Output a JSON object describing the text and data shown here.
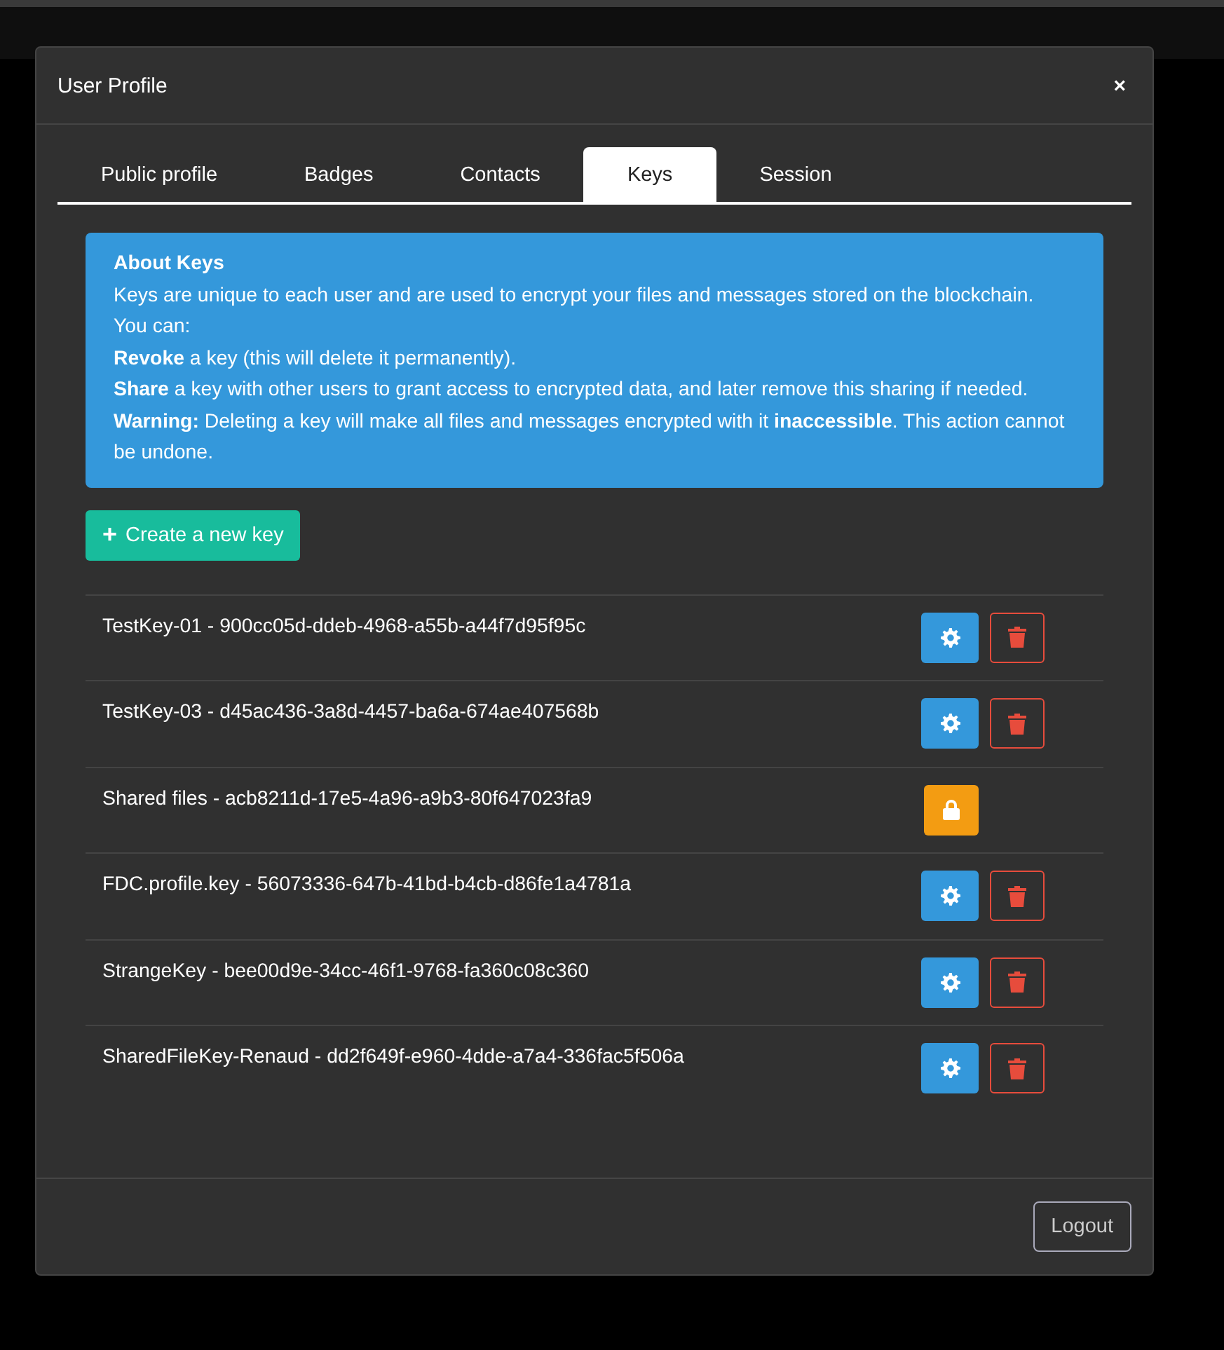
{
  "dialog": {
    "title": "User Profile",
    "close": "×"
  },
  "tabs": [
    {
      "label": "Public profile",
      "selected": false
    },
    {
      "label": "Badges",
      "selected": false
    },
    {
      "label": "Contacts",
      "selected": false
    },
    {
      "label": "Keys",
      "selected": true
    },
    {
      "label": "Session",
      "selected": false
    }
  ],
  "info": {
    "title": "About Keys",
    "lines": [
      "Keys are unique to each user and are used to encrypt your files and messages stored on the blockchain.",
      "You can:",
      "**Revoke** a key (this will delete it permanently).",
      "**Share** a key with other users to grant access to encrypted data, and later remove this sharing if needed.",
      "**Warning:** Deleting a key will make all files and messages encrypted with it **inaccessible**. This action cannot be undone."
    ]
  },
  "create_button": {
    "icon": "+",
    "label": "Create a new key"
  },
  "keys": [
    {
      "label": "TestKey-01 - 900cc05d-ddeb-4968-a55b-a44f7d95f95c",
      "kind": "owned"
    },
    {
      "label": "TestKey-03 - d45ac436-3a8d-4457-ba6a-674ae407568b",
      "kind": "owned"
    },
    {
      "label": "Shared files - acb8211d-17e5-4a96-a9b3-80f647023fa9",
      "kind": "locked"
    },
    {
      "label": "FDC.profile.key - 56073336-647b-41bd-b4cb-d86fe1a4781a",
      "kind": "owned"
    },
    {
      "label": "StrangeKey - bee00d9e-34cc-46f1-9768-fa360c08c360",
      "kind": "owned"
    },
    {
      "label": "SharedFileKey-Renaud - dd2f649f-e960-4dde-a7a4-336fac5f506a",
      "kind": "owned"
    }
  ],
  "footer": {
    "logout": "Logout"
  }
}
